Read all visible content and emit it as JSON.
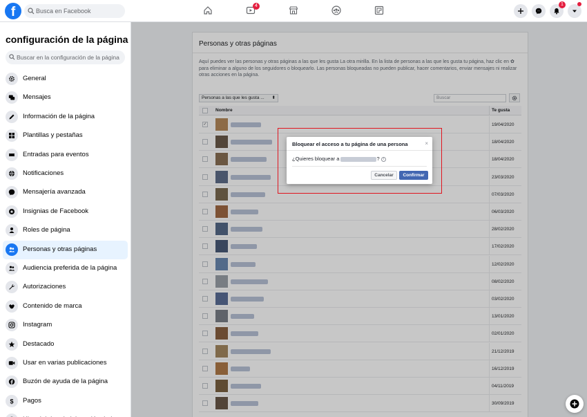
{
  "topbar": {
    "logo": "f",
    "search_placeholder": "Busca en Facebook",
    "nav": [
      {
        "name": "home-icon",
        "badge": ""
      },
      {
        "name": "watch-icon",
        "badge": "4"
      },
      {
        "name": "marketplace-icon",
        "badge": ""
      },
      {
        "name": "groups-icon",
        "badge": ""
      },
      {
        "name": "gaming-icon",
        "badge": ""
      }
    ],
    "notifications_badge": "1"
  },
  "sidebar": {
    "title": "configuración de la página",
    "search_placeholder": "Buscar en la configuración de la página",
    "items": [
      {
        "label": "General",
        "icon": "gear-icon",
        "active": false
      },
      {
        "label": "Mensajes",
        "icon": "messages-icon",
        "active": false
      },
      {
        "label": "Información de la página",
        "icon": "pencil-icon",
        "active": false
      },
      {
        "label": "Plantillas y pestañas",
        "icon": "grid-icon",
        "active": false
      },
      {
        "label": "Entradas para eventos",
        "icon": "ticket-icon",
        "active": false
      },
      {
        "label": "Notificaciones",
        "icon": "globe-icon",
        "active": false
      },
      {
        "label": "Mensajería avanzada",
        "icon": "messenger-icon",
        "active": false
      },
      {
        "label": "Insignias de Facebook",
        "icon": "badge-icon",
        "active": false
      },
      {
        "label": "Roles de página",
        "icon": "person-icon",
        "active": false
      },
      {
        "label": "Personas y otras páginas",
        "icon": "people-icon",
        "active": true
      },
      {
        "label": "Audiencia preferida de la página",
        "icon": "audience-icon",
        "active": false
      },
      {
        "label": "Autorizaciones",
        "icon": "wrench-icon",
        "active": false
      },
      {
        "label": "Contenido de marca",
        "icon": "handshake-icon",
        "active": false
      },
      {
        "label": "Instagram",
        "icon": "instagram-icon",
        "active": false
      },
      {
        "label": "Destacado",
        "icon": "star-icon",
        "active": false
      },
      {
        "label": "Usar en varias publicaciones",
        "icon": "video-icon",
        "active": false
      },
      {
        "label": "Buzón de ayuda de la página",
        "icon": "facebook-icon",
        "active": false
      },
      {
        "label": "Pagos",
        "icon": "dollar-icon",
        "active": false
      },
      {
        "label": "Historial de administración de la",
        "icon": "history-icon",
        "active": false
      }
    ]
  },
  "panel": {
    "title": "Personas y otras páginas",
    "description": "Aquí puedes ver las personas y otras páginas a las que les gusta La otra mirilla. En la lista de personas a las que les gusta tu página, haz clic en ✿ para eliminar a alguno de los seguidores o bloquearlo. Las personas bloqueadas no pueden publicar, hacer comentarios, enviar mensajes ni realizar otras acciones en la página.",
    "filter_label": "Personas a las que les gusta ...",
    "search_placeholder": "Buscar",
    "col_name": "Nombre",
    "col_date": "Te gusta",
    "rows": [
      {
        "date": "19/04/2020",
        "checked": true
      },
      {
        "date": "18/04/2020",
        "checked": false
      },
      {
        "date": "18/04/2020",
        "checked": false
      },
      {
        "date": "23/03/2020",
        "checked": false
      },
      {
        "date": "07/03/2020",
        "checked": false
      },
      {
        "date": "06/03/2020",
        "checked": false
      },
      {
        "date": "28/02/2020",
        "checked": false
      },
      {
        "date": "17/02/2020",
        "checked": false
      },
      {
        "date": "12/02/2020",
        "checked": false
      },
      {
        "date": "08/02/2020",
        "checked": false
      },
      {
        "date": "03/02/2020",
        "checked": false
      },
      {
        "date": "13/01/2020",
        "checked": false
      },
      {
        "date": "02/01/2020",
        "checked": false
      },
      {
        "date": "21/12/2019",
        "checked": false
      },
      {
        "date": "16/12/2019",
        "checked": false
      },
      {
        "date": "04/11/2019",
        "checked": false
      },
      {
        "date": "30/09/2019",
        "checked": false
      }
    ]
  },
  "dialog": {
    "title": "Bloquear el acceso a tu página de una persona",
    "close": "×",
    "question_prefix": "¿Quieres bloquear a",
    "question_suffix": "?",
    "info": "i",
    "cancel_label": "Cancelar",
    "confirm_label": "Confirmar"
  },
  "colors": {
    "brand": "#1877f2",
    "confirm_button": "#4267b2",
    "highlight_border": "#e0141e",
    "badge": "#e41e3f"
  }
}
